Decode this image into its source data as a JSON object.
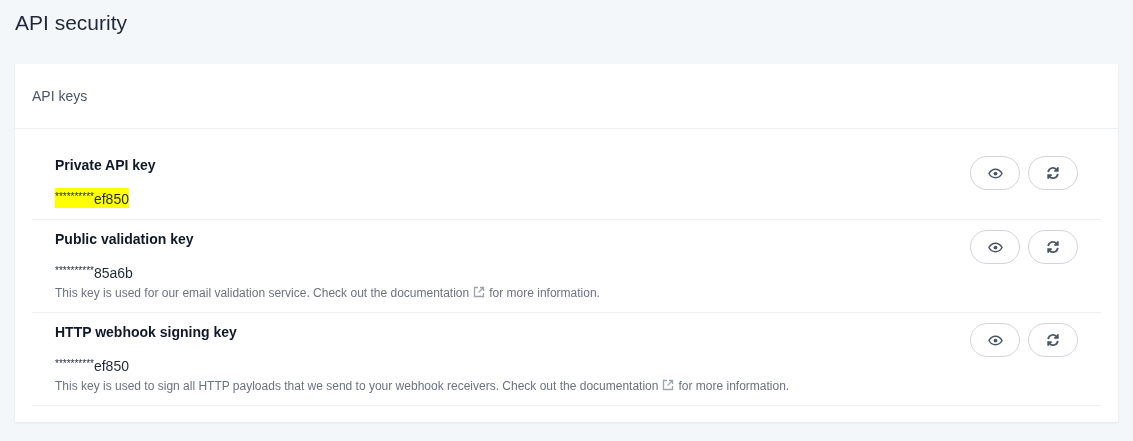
{
  "page_title": "API security",
  "card": {
    "title": "API keys",
    "keys": [
      {
        "name": "Private API key",
        "mask": "**********",
        "suffix": "ef850",
        "highlighted": true
      },
      {
        "name": "Public validation key",
        "mask": "**********",
        "suffix": "85a6b",
        "highlighted": false,
        "description": {
          "before": "This key is used for our email validation service. Check out the",
          "link": "documentation",
          "after": "for more information."
        }
      },
      {
        "name": "HTTP webhook signing key",
        "mask": "**********",
        "suffix": "ef850",
        "highlighted": false,
        "description": {
          "before": "This key is used to sign all HTTP payloads that we send to your webhook receivers. Check out the",
          "link": "documentation",
          "after": "for more information."
        }
      }
    ]
  }
}
